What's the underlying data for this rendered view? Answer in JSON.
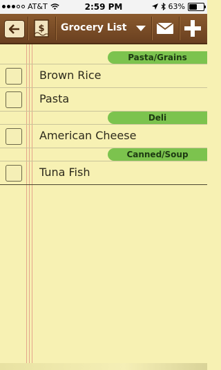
{
  "status_bar": {
    "carrier": "AT&T",
    "time": "2:59 PM",
    "battery": "63%",
    "battery_level": 0.63
  },
  "toolbar": {
    "title": "Grocery List"
  },
  "sections": [
    {
      "category": "Pasta/Grains",
      "items": [
        {
          "label": "Brown Rice",
          "checked": false
        },
        {
          "label": "Pasta",
          "checked": false
        }
      ]
    },
    {
      "category": "Deli",
      "items": [
        {
          "label": "American Cheese",
          "checked": false
        }
      ]
    },
    {
      "category": "Canned/Soup",
      "items": [
        {
          "label": "Tuna Fish",
          "checked": false
        }
      ]
    }
  ],
  "colors": {
    "toolbar": "#7a4d26",
    "paper": "#f7f1b3",
    "category_tag": "#7cc34e"
  }
}
